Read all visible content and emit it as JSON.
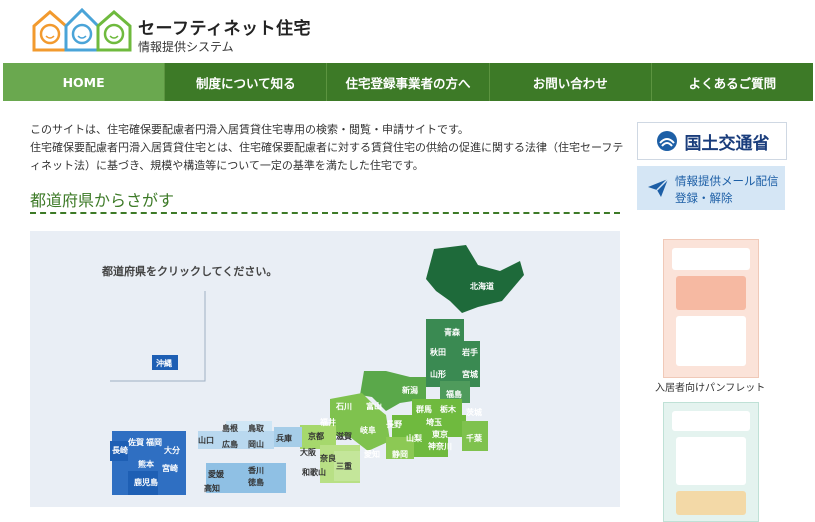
{
  "header": {
    "title": "セーフティネット住宅",
    "subtitle": "情報提供システム"
  },
  "nav": {
    "items": [
      {
        "label": "HOME",
        "active": true
      },
      {
        "label": "制度について知る",
        "active": false
      },
      {
        "label": "住宅登録事業者の方へ",
        "active": false
      },
      {
        "label": "お問い合わせ",
        "active": false
      },
      {
        "label": "よくあるご質問",
        "active": false
      }
    ]
  },
  "intro": {
    "line1": "このサイトは、住宅確保要配慮者円滑入居賃貸住宅専用の検索・閲覧・申請サイトです。",
    "line2": "住宅確保要配慮者円滑入居賃貸住宅とは、住宅確保要配慮者に対する賃貸住宅の供給の促進に関する法律（住宅セーフティネット法）に基づき、規模や構造等について一定の基準を満たした住宅です。"
  },
  "section": {
    "title": "都道府県からさがす"
  },
  "map": {
    "instruction": "都道府県をクリックしてください。",
    "prefectures": {
      "hokkaido": "北海道",
      "aomori": "青森",
      "akita": "秋田",
      "iwate": "岩手",
      "yamagata": "山形",
      "miyagi": "宮城",
      "fukushima": "福島",
      "niigata": "新潟",
      "ishikawa": "石川",
      "toyama": "富山",
      "gunma": "群馬",
      "tochigi": "栃木",
      "ibaraki": "茨城",
      "nagano": "長野",
      "saitama": "埼玉",
      "yamanashi": "山梨",
      "tokyo": "東京",
      "kanagawa": "神奈川",
      "chiba": "千葉",
      "fukui": "福井",
      "gifu": "岐阜",
      "shizuoka": "静岡",
      "aichi": "愛知",
      "kyoto": "京都",
      "shiga": "滋賀",
      "hyogo": "兵庫",
      "osaka": "大阪",
      "nara": "奈良",
      "mie": "三重",
      "wakayama": "和歌山",
      "shimane": "島根",
      "tottori": "鳥取",
      "yamaguchi": "山口",
      "hiroshima": "広島",
      "okayama": "岡山",
      "ehime": "愛媛",
      "kagawa": "香川",
      "tokushima": "徳島",
      "kochi": "高知",
      "saga": "佐賀",
      "fukuoka": "福岡",
      "nagasaki": "長崎",
      "oita": "大分",
      "kumamoto": "熊本",
      "miyazaki": "宮崎",
      "kagoshima": "鹿児島",
      "okinawa": "沖縄"
    }
  },
  "sidebar": {
    "mlit_label": "国土交通省",
    "mail_line1": "情報提供メール配信",
    "mail_line2": "登録・解除",
    "pamphlet1_label": "入居者向けパンフレット"
  },
  "colors": {
    "nav_bg": "#3d7a27",
    "nav_active": "#6aa84f",
    "accent_green": "#3d7a27",
    "link_blue": "#1d5fa6"
  }
}
